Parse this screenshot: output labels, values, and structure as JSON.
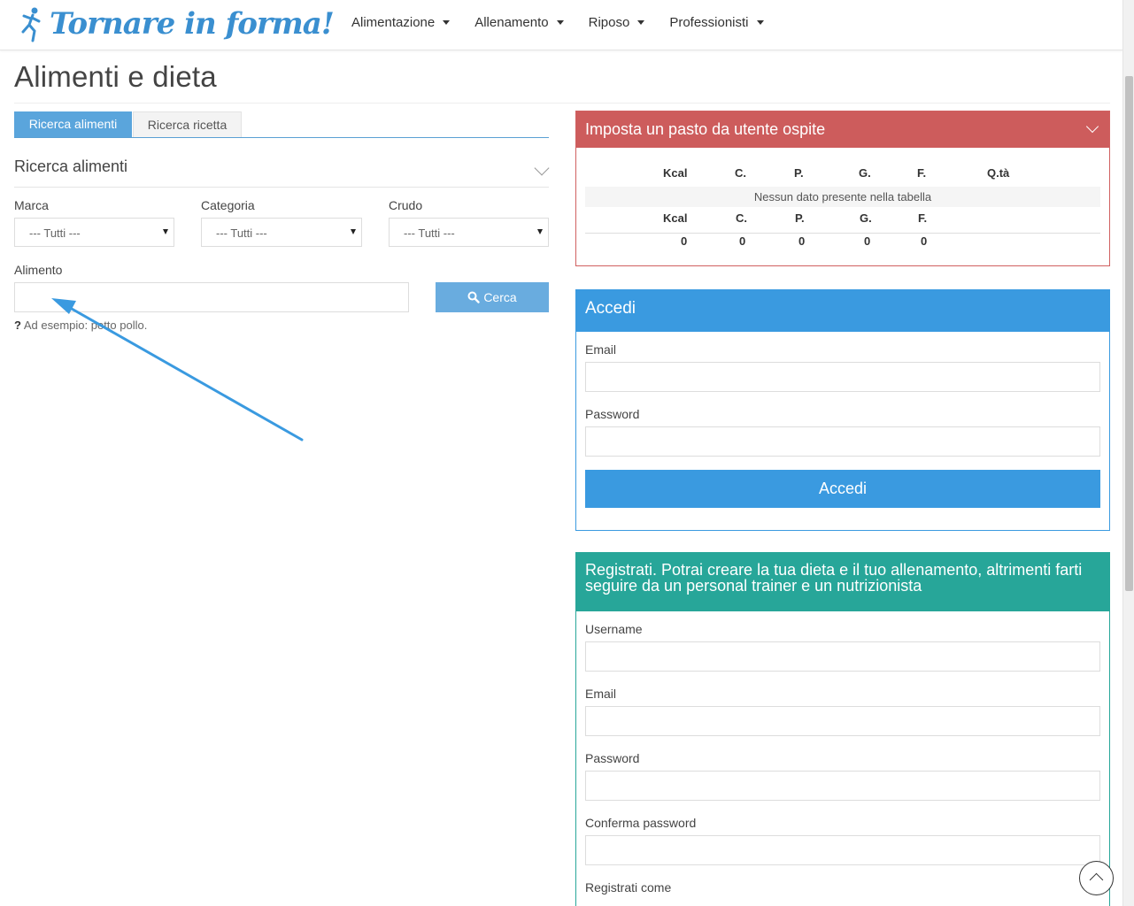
{
  "header": {
    "logo_text": "Tornare in forma!",
    "nav": [
      "Alimentazione",
      "Allenamento",
      "Riposo",
      "Professionisti"
    ]
  },
  "page": {
    "title": "Alimenti e dieta"
  },
  "left": {
    "tabs": [
      "Ricerca alimenti",
      "Ricerca ricetta"
    ],
    "section_title": "Ricerca alimenti",
    "filters": {
      "marca_label": "Marca",
      "categoria_label": "Categoria",
      "crudo_label": "Crudo",
      "select_value": "--- Tutti ---"
    },
    "alimento_label": "Alimento",
    "alimento_value": "",
    "search_button": "Cerca",
    "hint": "Ad esempio: petto pollo."
  },
  "meal_panel": {
    "title": "Imposta un pasto da utente ospite",
    "columns": [
      "Kcal",
      "C.",
      "P.",
      "G.",
      "F.",
      "Q.tà"
    ],
    "empty_text": "Nessun dato presente nella tabella",
    "footer_columns": [
      "Kcal",
      "C.",
      "P.",
      "G.",
      "F."
    ],
    "totals": [
      "0",
      "0",
      "0",
      "0",
      "0"
    ]
  },
  "login_panel": {
    "title": "Accedi",
    "email_label": "Email",
    "password_label": "Password",
    "button": "Accedi"
  },
  "register_panel": {
    "title": "Registrati. Potrai creare la tua dieta e il tuo allenamento, altrimenti farti seguire da un personal trainer e un nutrizionista",
    "username_label": "Username",
    "email_label": "Email",
    "password_label": "Password",
    "confirm_label": "Conferma password",
    "register_as_label": "Registrati come"
  },
  "colors": {
    "accent_blue": "#3a9ae0",
    "tab_blue": "#5aa5dc",
    "panel_red": "#cd5c5c",
    "panel_green": "#27a699",
    "arrow": "#3a9ae0"
  }
}
